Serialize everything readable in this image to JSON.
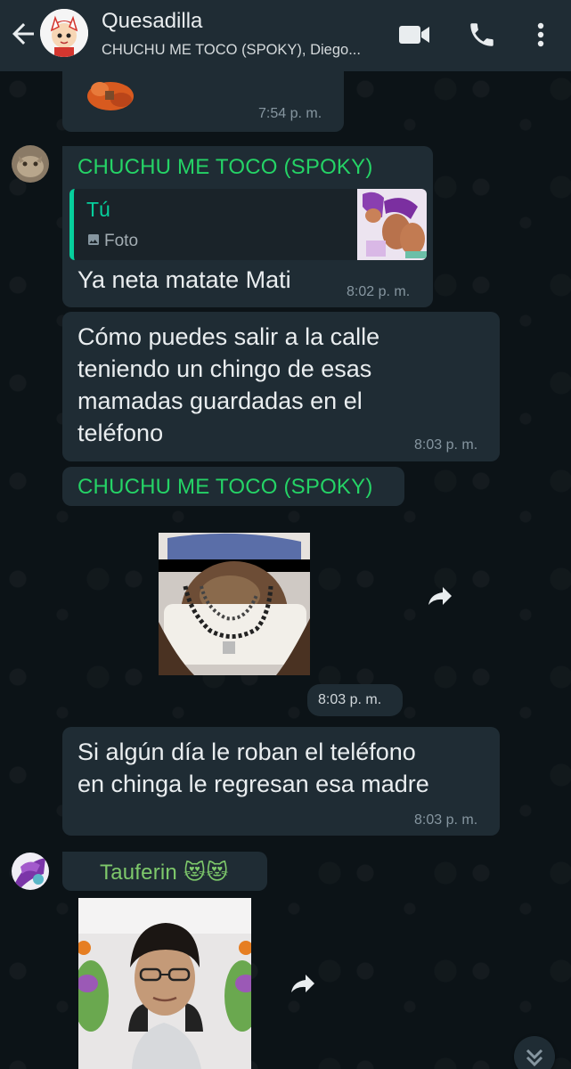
{
  "header": {
    "title": "Quesadilla",
    "subtitle": "CHUCHU ME TOCO (SPOKY), Diego...",
    "icons": [
      "back-arrow-icon",
      "video-call-icon",
      "phone-icon",
      "more-vert-icon"
    ]
  },
  "messages": [
    {
      "id": "m0",
      "type": "sticker-partial",
      "time": "7:54 p. m."
    },
    {
      "id": "m1",
      "sender": "CHUCHU ME TOCO (SPOKY)",
      "quote": {
        "author": "Tú",
        "kind": "Foto"
      },
      "text": "Ya neta matate Mati",
      "time": "8:02 p. m."
    },
    {
      "id": "m2",
      "text_lines": [
        "Cómo puedes salir a la calle",
        "teniendo un chingo de esas",
        "mamadas guardadas en el",
        "teléfono"
      ],
      "time": "8:03 p. m."
    },
    {
      "id": "m3",
      "sender": "CHUCHU ME TOCO (SPOKY)"
    },
    {
      "id": "m4",
      "type": "sticker",
      "time": "8:03 p. m."
    },
    {
      "id": "m5",
      "text_lines": [
        "Si algún día le roban el teléfono",
        "en chinga le regresan esa madre"
      ],
      "time": "8:03 p. m."
    },
    {
      "id": "m6",
      "sender": "Tauferin 😻😻",
      "type": "image"
    }
  ],
  "colors": {
    "header_bg": "#1f2c34",
    "bubble_bg": "#1f2c34",
    "chat_bg": "#0b141a",
    "sender_green": "#25d366",
    "quote_bar": "#06cf9c"
  }
}
